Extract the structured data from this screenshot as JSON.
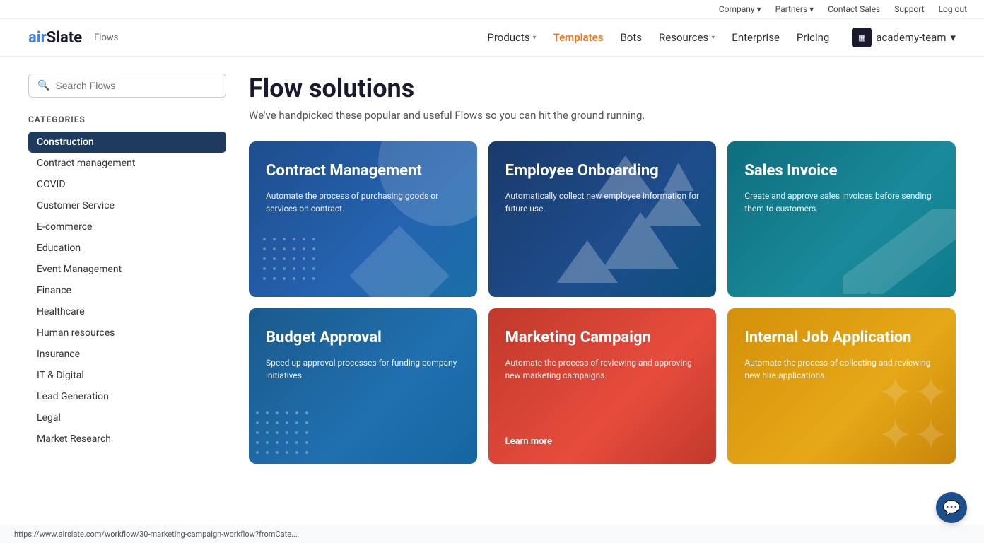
{
  "topbar": {
    "items": [
      {
        "label": "Company",
        "hasChevron": true
      },
      {
        "label": "Partners",
        "hasChevron": true
      },
      {
        "label": "Contact Sales",
        "hasChevron": false
      },
      {
        "label": "Support",
        "hasChevron": false
      },
      {
        "label": "Log out",
        "hasChevron": false
      }
    ]
  },
  "navbar": {
    "logo_text": "airSlate",
    "logo_flows": "Flows",
    "links": [
      {
        "label": "Products",
        "hasChevron": true,
        "active": false
      },
      {
        "label": "Templates",
        "hasChevron": false,
        "active": true
      },
      {
        "label": "Bots",
        "hasChevron": false,
        "active": false
      },
      {
        "label": "Resources",
        "hasChevron": true,
        "active": false
      },
      {
        "label": "Enterprise",
        "hasChevron": false,
        "active": false
      },
      {
        "label": "Pricing",
        "hasChevron": false,
        "active": false
      }
    ],
    "academy_label": "academy-team",
    "academy_icon": "▦"
  },
  "sidebar": {
    "search_placeholder": "Search Flows",
    "categories_label": "CATEGORIES",
    "items": [
      {
        "label": "Construction",
        "active": true
      },
      {
        "label": "Contract management",
        "active": false
      },
      {
        "label": "COVID",
        "active": false
      },
      {
        "label": "Customer Service",
        "active": false
      },
      {
        "label": "E-commerce",
        "active": false
      },
      {
        "label": "Education",
        "active": false
      },
      {
        "label": "Event Management",
        "active": false
      },
      {
        "label": "Finance",
        "active": false
      },
      {
        "label": "Healthcare",
        "active": false
      },
      {
        "label": "Human resources",
        "active": false
      },
      {
        "label": "Insurance",
        "active": false
      },
      {
        "label": "IT & Digital",
        "active": false
      },
      {
        "label": "Lead Generation",
        "active": false
      },
      {
        "label": "Legal",
        "active": false
      },
      {
        "label": "Market Research",
        "active": false
      }
    ]
  },
  "main": {
    "title": "Flow solutions",
    "subtitle": "We've handpicked these popular and useful Flows so you can hit the ground running.",
    "cards": [
      {
        "id": "contract-management",
        "title": "Contract Management",
        "description": "Automate the process of purchasing goods or services on contract.",
        "color": "blue",
        "learn_more": false
      },
      {
        "id": "employee-onboarding",
        "title": "Employee Onboarding",
        "description": "Automatically collect new employee information for future use.",
        "color": "navy",
        "learn_more": false
      },
      {
        "id": "sales-invoice",
        "title": "Sales Invoice",
        "description": "Create and approve sales invoices before sending them to customers.",
        "color": "teal",
        "learn_more": false
      },
      {
        "id": "budget-approval",
        "title": "Budget Approval",
        "description": "Speed up approval processes for funding company initiatives.",
        "color": "blue2",
        "learn_more": false
      },
      {
        "id": "marketing-campaign",
        "title": "Marketing Campaign",
        "description": "Automate the process of reviewing and approving new marketing campaigns.",
        "color": "red",
        "learn_more": true,
        "learn_more_label": "Learn more"
      },
      {
        "id": "internal-job-application",
        "title": "Internal Job Application",
        "description": "Automate the process of collecting and reviewing new hire applications.",
        "color": "yellow",
        "learn_more": false
      }
    ]
  },
  "bottom_bar": {
    "url": "https://www.airslate.com/workflow/30-marketing-campaign-workflow?fromCate..."
  },
  "chat": {
    "icon": "💬"
  }
}
